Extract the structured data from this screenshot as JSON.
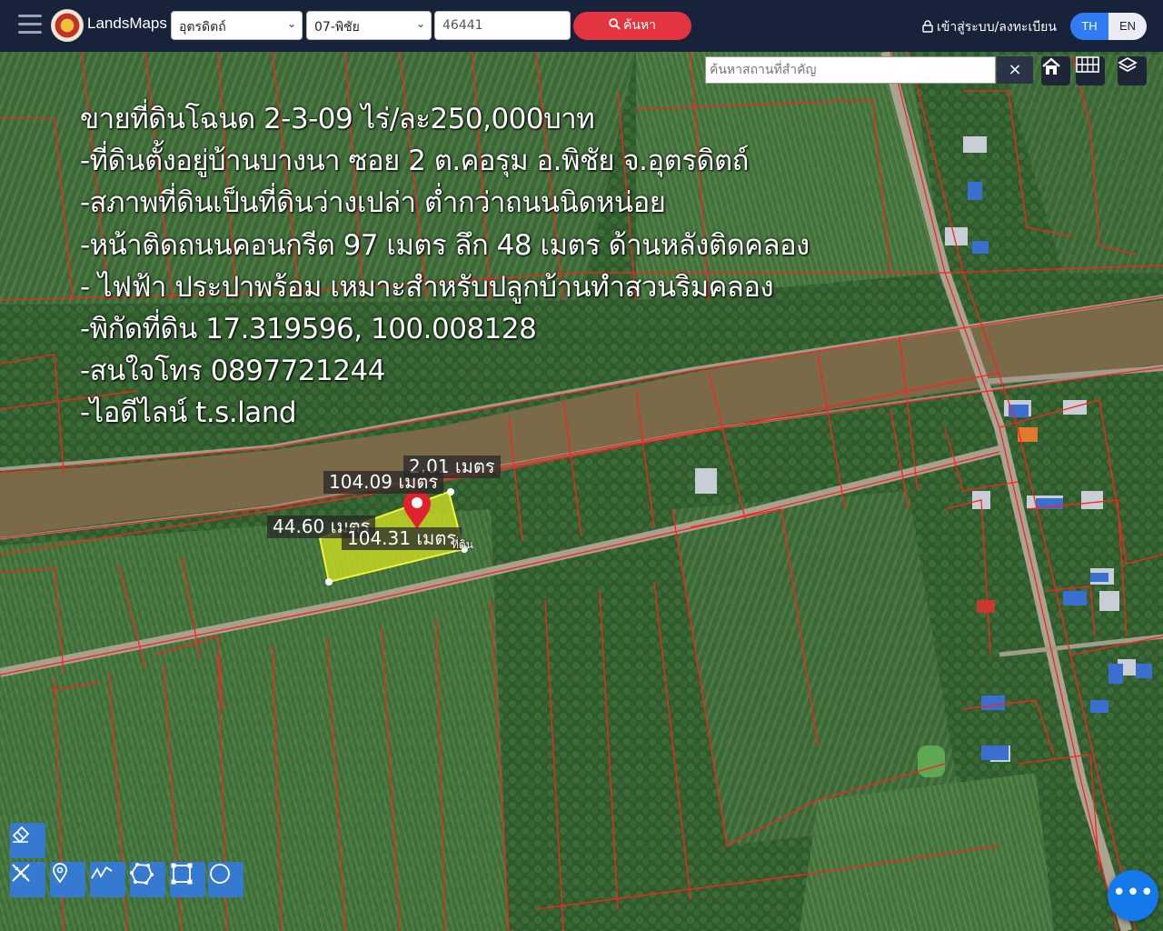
{
  "header": {
    "app_name": "LandsMaps",
    "province": "อุตรดิตถ์",
    "district": "07-พิชัย",
    "parcel_no": "46441",
    "search_label": "ค้นหา",
    "login_label": "เข้าสู่ระบบ/ลงทะเบียน",
    "lang_th": "TH",
    "lang_en": "EN"
  },
  "map": {
    "place_search_placeholder": "ค้นหาสถานที่สำคัญ",
    "clear_label": "×",
    "overlay_lines": [
      "ขายที่ดินโฉนด 2-3-09 ไร่/ละ250,000บาท",
      "-ที่ดินตั้งอยู่บ้านบางนา ซอย 2 ต.คอรุม อ.พิชัย จ.อุตรดิตถ์",
      "-สภาพที่ดินเป็นที่ดินว่างเปล่า ต่ำกว่าถนนนิดหน่อย",
      "-หน้าติดถนนคอนกรีต 97 เมตร ลึก 48 เมตร ด้านหลังติดคลอง",
      "- ไฟฟ้า ประปาพร้อม เหมาะสำหรับปลูกบ้านทำสวนริมคลอง",
      "-พิกัดที่ดิน 17.319596, 100.008128",
      "-สนใจโทร 0897721244",
      "-ไอดีไลน์ t.s.land"
    ],
    "measurements": {
      "top_short": "2.01 เมตร",
      "top_long": "104.09 เมตร",
      "left_side": "44.60 เมตร",
      "bottom_long": "104.31 เมตร"
    },
    "parcel_small_label": "ที่ดิน"
  },
  "tools": {
    "eraser": "eraser-icon",
    "measure": "ruler-pencil-icon",
    "marker": "map-pin-icon",
    "line": "polyline-icon",
    "polygon": "polygon-icon",
    "rectangle": "rectangle-icon",
    "circle": "circle-icon"
  },
  "chat_label": "•••",
  "colors": {
    "topbar": "#18233b",
    "search_button": "#e4343f",
    "lang_active": "#2f7cf6",
    "parcel_lines": "#ff2020",
    "selected_parcel": "#c8d822",
    "pin": "#e0222e",
    "tool_button": "#3679d1"
  }
}
